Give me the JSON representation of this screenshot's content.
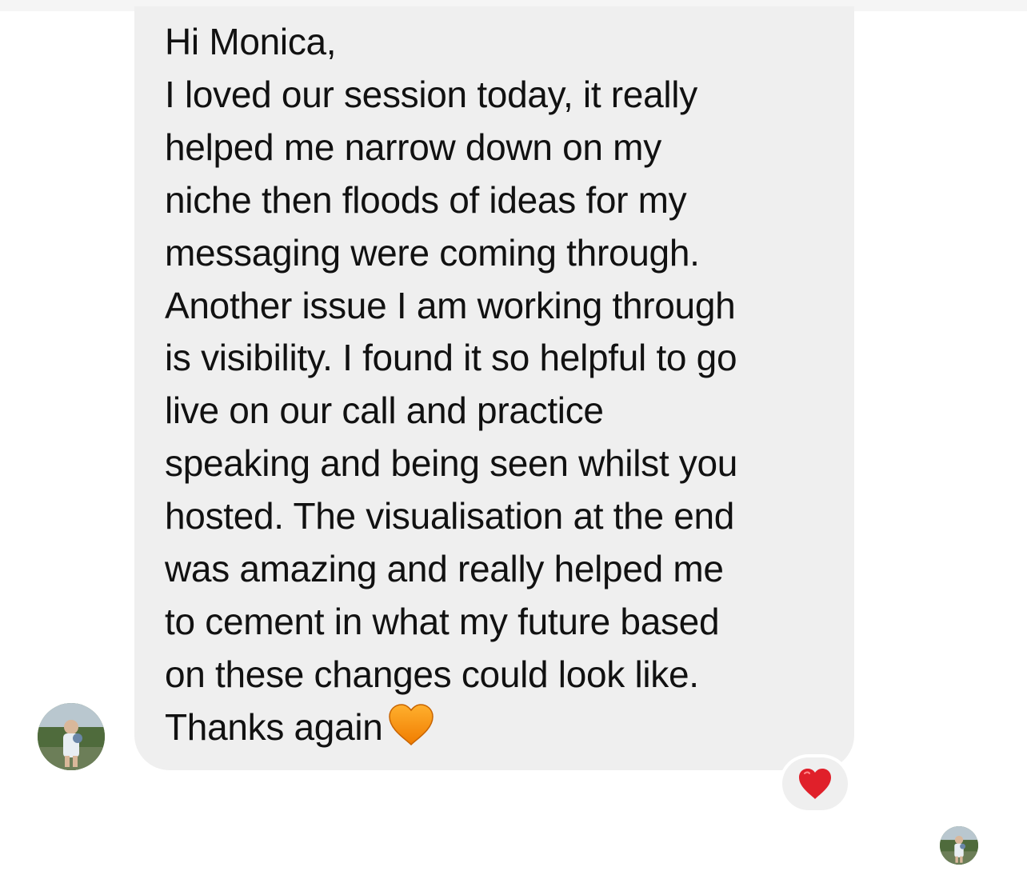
{
  "message": {
    "lines": [
      "Hi Monica,",
      "I loved our session today, it really",
      "helped me narrow down on my",
      "niche then floods of ideas for my",
      "messaging were coming through.",
      "Another issue I am working through",
      "is visibility. I found it so helpful to go",
      "live on our call and practice",
      "speaking and being seen whilst you",
      "hosted. The visualisation at the end",
      "was amazing and really helped me",
      "to cement in what my future based",
      "on these changes could look like.",
      "Thanks again"
    ],
    "emoji": "orange-heart-icon",
    "bubble_color": "#efefef",
    "text_color": "#111111"
  },
  "reaction": {
    "emoji": "red-heart-icon",
    "color": "#e0202a"
  },
  "sender_avatar": {
    "icon": "profile-photo-avatar"
  },
  "seen_avatar": {
    "icon": "profile-photo-avatar"
  }
}
